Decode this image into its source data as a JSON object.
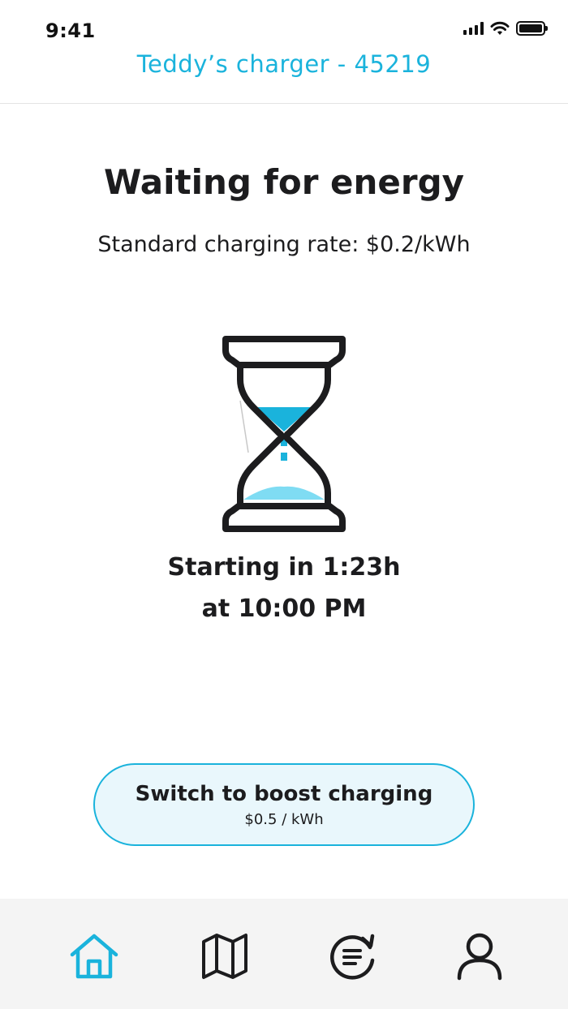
{
  "status_bar": {
    "time": "9:41",
    "icons": [
      "signal-icon",
      "wifi-icon",
      "battery-icon"
    ]
  },
  "header": {
    "title": "Teddy’s charger - 45219"
  },
  "main": {
    "heading": "Waiting for energy",
    "rate": "Standard charging rate: $0.2/kWh",
    "illustration": "hourglass-icon",
    "start_line1": "Starting in 1:23h",
    "start_line2": "at 10:00 PM"
  },
  "boost_button": {
    "label": "Switch to boost charging",
    "rate": "$0.5 / kWh"
  },
  "bottom_nav": {
    "items": [
      {
        "icon": "home-icon",
        "active": true
      },
      {
        "icon": "map-icon",
        "active": false
      },
      {
        "icon": "history-icon",
        "active": false
      },
      {
        "icon": "profile-icon",
        "active": false
      }
    ]
  },
  "colors": {
    "accent": "#1ab3dc",
    "accent_light": "#7fdcf3",
    "text": "#1c1c1e",
    "button_bg": "#e9f7fc",
    "nav_bg": "#f4f4f4"
  }
}
